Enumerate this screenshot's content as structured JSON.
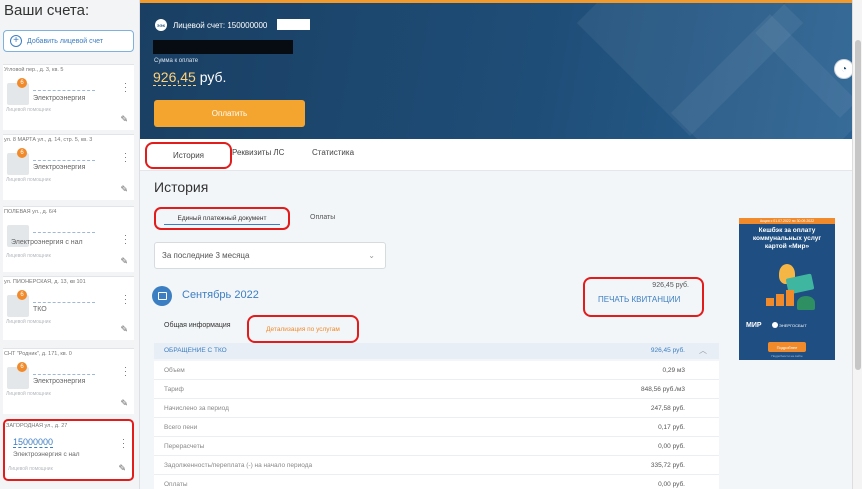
{
  "sidebar": {
    "title": "Ваши счета:",
    "add_button_label": "Добавить лицевой счет",
    "accounts": [
      {
        "address": "Угловой пер., д. 3, кв. 5",
        "service": "Электроэнергия",
        "badge": "6",
        "meta": "Лицевой помощник"
      },
      {
        "address": "ул. 8 МАРТА ул., д. 14, стр. 5, кв. 3",
        "service": "Электроэнергия",
        "badge": "6",
        "meta": "Лицевой помощник"
      },
      {
        "address": "ПОЛЕВАЯ ул., д. 6/4",
        "service": "Электроэнергия с нал",
        "badge": "",
        "meta": "Лицевой помощник"
      },
      {
        "address": "ул. ПИОНЕРСКАЯ, д. 13, кв 101",
        "service": "ТКО",
        "badge": "6",
        "meta": "Лицевой помощник"
      },
      {
        "address": "СНТ \"Родник\", д. 171, кв. 0",
        "service": "Электроэнергия",
        "badge": "6",
        "meta": "Лицевой помощник"
      },
      {
        "address": "ЗАГОРОДНАЯ ул., д. 27",
        "account_number": "15000000",
        "service": "Электроэнергия с нал",
        "badge": "",
        "meta": "Лицевой помощник"
      }
    ]
  },
  "banner": {
    "logo": "ЭЭК",
    "account_label": "Лицевой счет: 150000000",
    "due_label": "Сумма к оплате",
    "amount": "926,45",
    "currency": "руб.",
    "pay_button": "Оплатить"
  },
  "tabs": [
    "История",
    "Реквизиты ЛС",
    "Статистика"
  ],
  "history": {
    "title": "История",
    "subtabs": [
      "Единый платежный документ",
      "Оплаты"
    ],
    "period_select": "За последние 3 месяца",
    "period_title": "Сентябрь 2022",
    "period_amount": "926,45 руб.",
    "print_link": "ПЕЧАТЬ КВИТАНЦИИ",
    "detail_tabs": [
      "Общая информация",
      "Детализация по услугам"
    ],
    "service": {
      "name": "ОБРАЩЕНИЕ С ТКО",
      "amount": "926,45 руб."
    },
    "rows": [
      {
        "label": "Объем",
        "value": "0,29 м3"
      },
      {
        "label": "Тариф",
        "value": "848,56 руб./м3"
      },
      {
        "label": "Начислено за период",
        "value": "247,58 руб."
      },
      {
        "label": "Всего пени",
        "value": "0,17 руб."
      },
      {
        "label": "Перерасчеты",
        "value": "0,00 руб."
      },
      {
        "label": "Задолженность/переплата (-) на начало периода",
        "value": "335,72 руб."
      },
      {
        "label": "Оплаты",
        "value": "0,00 руб."
      }
    ]
  },
  "ad": {
    "top_line": "Акция с 01.07.2022 по 30.09.2022",
    "headline": "Кешбэк за оплату коммунальных услуг картой «Мир»",
    "brand": "МИР",
    "partner": "ЭНЕРГОСБЫТ",
    "cta": "Подробнее",
    "footnote": "Подробности на сайте"
  },
  "colors": {
    "accent": "#3c7ec2",
    "highlight": "#e21b1b",
    "orange": "#f4a530",
    "banner": "#1e4d77"
  }
}
